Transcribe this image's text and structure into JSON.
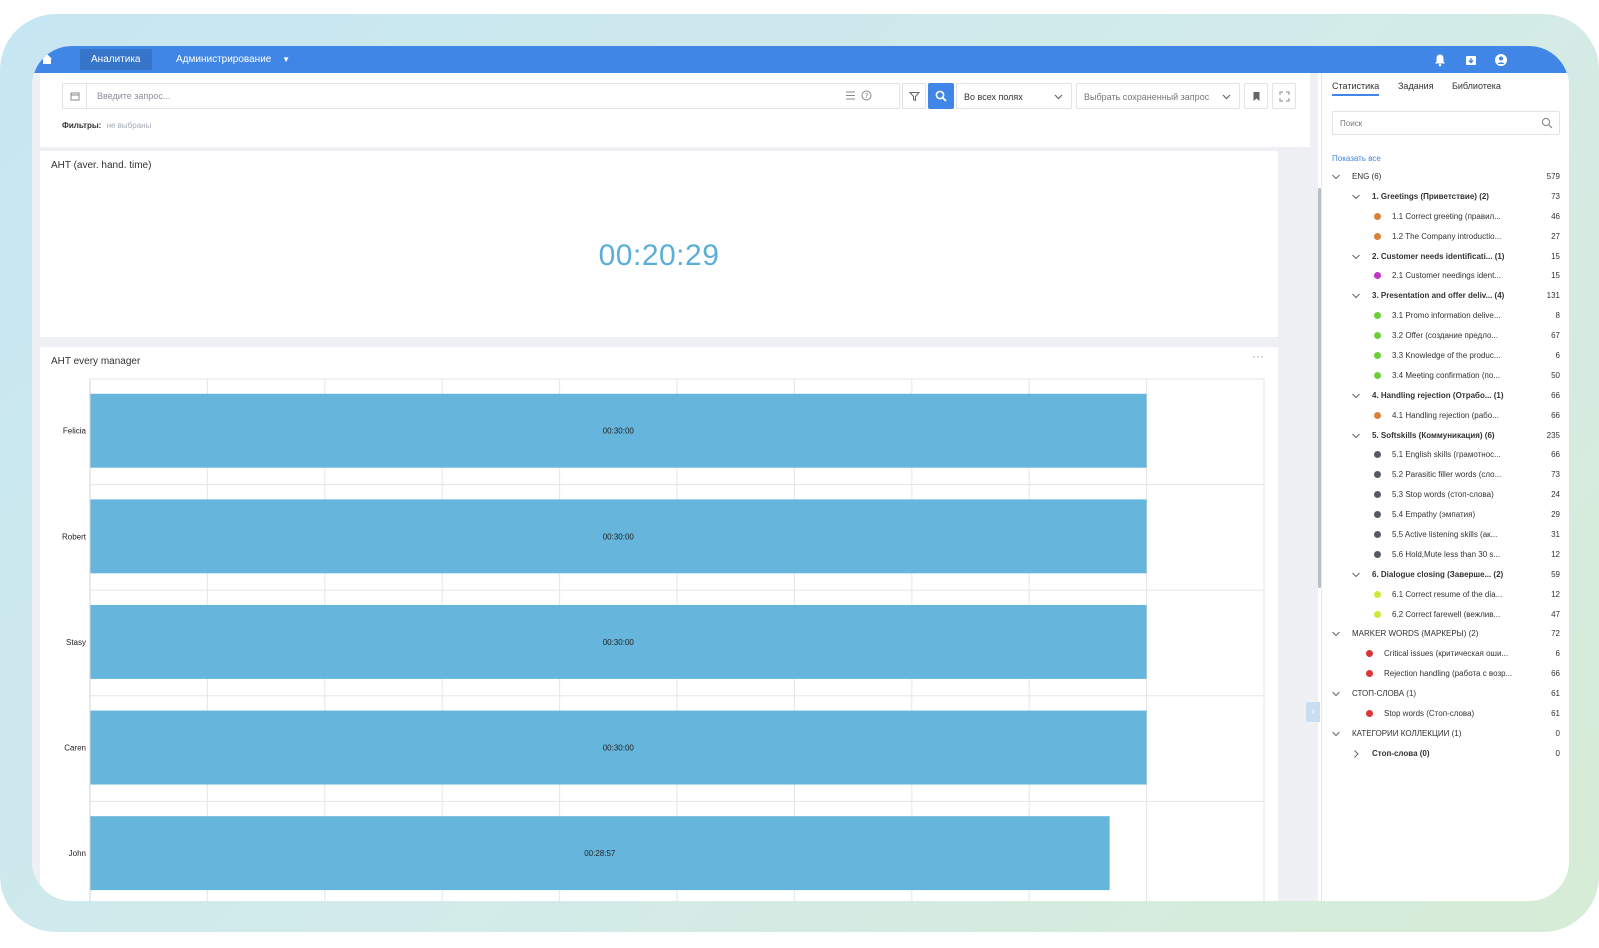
{
  "nav": {
    "tabs": [
      {
        "label": "Аналитика",
        "active": true
      },
      {
        "label": "Администрирование",
        "active": false
      }
    ],
    "icons": [
      "home-icon",
      "bell-icon",
      "download-icon",
      "user-icon"
    ]
  },
  "query": {
    "placeholder": "Введите запрос...",
    "fields_select": "Во всех полях",
    "saved_select": "Выбрать сохраненный запрос",
    "filters_label": "Фильтры:",
    "filters_value": "не выбраны"
  },
  "aht_card": {
    "title": "AHT (aver. hand. time)",
    "value": "00:20:29"
  },
  "manager_card": {
    "title": "AHT every manager",
    "menu": "···"
  },
  "chart_data": {
    "type": "bar",
    "orientation": "horizontal",
    "title": "AHT every manager",
    "categories": [
      "Felicia",
      "Robert",
      "Stasy",
      "Caren",
      "John"
    ],
    "values_seconds": [
      1800,
      1800,
      1800,
      1800,
      1737
    ],
    "data_labels": [
      "00:30:00",
      "00:30:00",
      "00:30:00",
      "00:30:00",
      "00:28:57"
    ],
    "xlim_seconds": [
      0,
      2000
    ],
    "grid": true,
    "color": "#66b5dc"
  },
  "side": {
    "tabs": [
      {
        "label": "Статистика",
        "active": true
      },
      {
        "label": "Задания",
        "active": false
      },
      {
        "label": "Библиотека",
        "active": false
      }
    ],
    "search_placeholder": "Поиск",
    "show_all": "Показать все",
    "tree": [
      {
        "level": 0,
        "type": "group",
        "expanded": true,
        "bold": false,
        "label": "ENG (6)",
        "count": "579"
      },
      {
        "level": 1,
        "type": "group",
        "expanded": true,
        "bold": true,
        "label": "1. Greetings (Приветствие) (2)",
        "count": "73"
      },
      {
        "level": 2,
        "type": "item",
        "color": "#d98236",
        "label": "1.1 Correct greeting (правил...",
        "count": "46"
      },
      {
        "level": 2,
        "type": "item",
        "color": "#d98236",
        "label": "1.2 The Company introductio...",
        "count": "27"
      },
      {
        "level": 1,
        "type": "group",
        "expanded": true,
        "bold": true,
        "label": "2. Customer needs identificati... (1)",
        "count": "15"
      },
      {
        "level": 2,
        "type": "item",
        "color": "#c236c4",
        "label": "2.1 Customer needings ident...",
        "count": "15"
      },
      {
        "level": 1,
        "type": "group",
        "expanded": true,
        "bold": true,
        "label": "3. Presentation and offer deliv... (4)",
        "count": "131"
      },
      {
        "level": 2,
        "type": "item",
        "color": "#6ccf3a",
        "label": "3.1 Promo information delive...",
        "count": "8"
      },
      {
        "level": 2,
        "type": "item",
        "color": "#6ccf3a",
        "label": "3.2 Offer (создание предло...",
        "count": "67"
      },
      {
        "level": 2,
        "type": "item",
        "color": "#6ccf3a",
        "label": "3.3 Knowledge of the produc...",
        "count": "6"
      },
      {
        "level": 2,
        "type": "item",
        "color": "#6ccf3a",
        "label": "3.4 Meeting confirmation (по...",
        "count": "50"
      },
      {
        "level": 1,
        "type": "group",
        "expanded": true,
        "bold": true,
        "label": "4. Handling rejection (Отрабо... (1)",
        "count": "66"
      },
      {
        "level": 2,
        "type": "item",
        "color": "#d98236",
        "label": "4.1 Handling rejection (рабо...",
        "count": "66"
      },
      {
        "level": 1,
        "type": "group",
        "expanded": true,
        "bold": true,
        "label": "5. Softskills (Коммуникация) (6)",
        "count": "235"
      },
      {
        "level": 2,
        "type": "item",
        "color": "#555a66",
        "label": "5.1 English skills (грамотнос...",
        "count": "66"
      },
      {
        "level": 2,
        "type": "item",
        "color": "#555a66",
        "label": "5.2 Parasitic filler words (сло...",
        "count": "73"
      },
      {
        "level": 2,
        "type": "item",
        "color": "#555a66",
        "label": "5.3 Stop words (стоп-слова)",
        "count": "24"
      },
      {
        "level": 2,
        "type": "item",
        "color": "#555a66",
        "label": "5.4 Empathy (эмпатия)",
        "count": "29"
      },
      {
        "level": 2,
        "type": "item",
        "color": "#555a66",
        "label": "5.5 Active listening skills (ак...",
        "count": "31"
      },
      {
        "level": 2,
        "type": "item",
        "color": "#555a66",
        "label": "5.6 Hold,Mute less than 30 s...",
        "count": "12"
      },
      {
        "level": 1,
        "type": "group",
        "expanded": true,
        "bold": true,
        "label": "6. Dialogue closing (Заверше... (2)",
        "count": "59"
      },
      {
        "level": 2,
        "type": "item",
        "color": "#cfe83a",
        "label": "6.1 Correct resume of the dia...",
        "count": "12"
      },
      {
        "level": 2,
        "type": "item",
        "color": "#cfe83a",
        "label": "6.2 Correct farewell (вежлив...",
        "count": "47"
      },
      {
        "level": 0,
        "type": "group",
        "expanded": true,
        "bold": false,
        "label": "MARKER WORDS (МАРКЕРЫ) (2)",
        "count": "72"
      },
      {
        "level": 1,
        "type": "item",
        "color": "#d93636",
        "label": "Critical issues (критическая оши...",
        "count": "6"
      },
      {
        "level": 1,
        "type": "item",
        "color": "#d93636",
        "label": "Rejection handling (работа с возр...",
        "count": "66"
      },
      {
        "level": 0,
        "type": "group",
        "expanded": true,
        "bold": false,
        "label": "СТОП-СЛОВА (1)",
        "count": "61"
      },
      {
        "level": 1,
        "type": "item",
        "color": "#d93636",
        "label": "Stop words (Стоп-слова)",
        "count": "61"
      },
      {
        "level": 0,
        "type": "group",
        "expanded": true,
        "bold": false,
        "label": "КАТЕГОРИИ КОЛЛЕКЦИИ (1)",
        "count": "0"
      },
      {
        "level": 1,
        "type": "group",
        "expanded": false,
        "bold": true,
        "label": "Стоп-слова (0)",
        "count": "0"
      }
    ]
  }
}
